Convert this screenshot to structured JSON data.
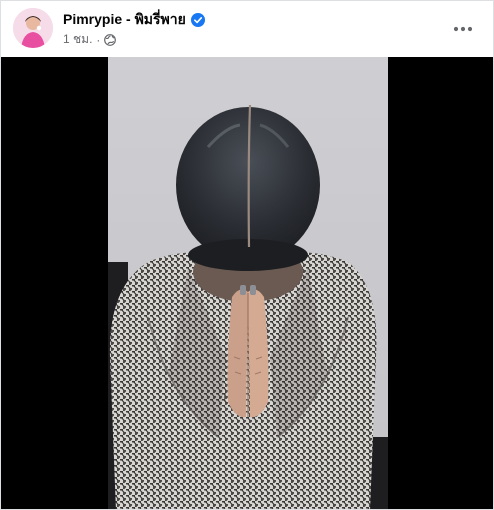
{
  "post": {
    "author": {
      "name": "Pimrypie - พิมรี่พาย",
      "verified": true,
      "avatar_icon": "profile-avatar"
    },
    "meta": {
      "time": "1 ชม.",
      "separator": "·",
      "privacy_icon": "globe-icon"
    },
    "more_icon": "more-options-icon",
    "media": {
      "type": "video",
      "scene": "person bowing with hands pressed together in a wai gesture, houndstooth jacket, gray backdrop"
    }
  },
  "colors": {
    "name_text": "#050505",
    "meta_text": "#65676b",
    "verified_badge": "#1877f2",
    "video_letterbox": "#000000",
    "backdrop": "#c9c9cd",
    "hair": "#2a2d33"
  }
}
